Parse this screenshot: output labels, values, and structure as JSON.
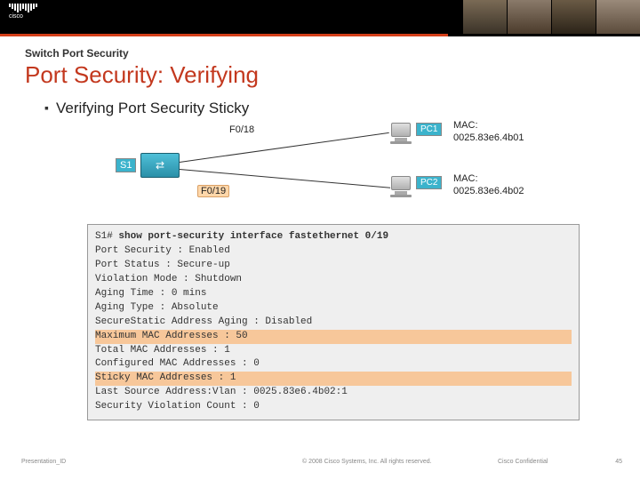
{
  "header": {
    "brand": "cisco"
  },
  "slide": {
    "overline": "Switch Port Security",
    "title": "Port Security: Verifying",
    "bullet": "Verifying Port Security Sticky"
  },
  "diagram": {
    "switch_label": "S1",
    "port_top": "F0/18",
    "port_bottom": "F0/19",
    "pc1_label": "PC1",
    "pc2_label": "PC2",
    "mac_label": "MAC:",
    "mac1": "0025.83e6.4b01",
    "mac2": "0025.83e6.4b02"
  },
  "terminal": {
    "prompt": "S1# ",
    "command": "show port-security interface fastethernet 0/19",
    "lines": [
      "Port Security : Enabled",
      "Port Status : Secure-up",
      "Violation Mode : Shutdown",
      "Aging Time : 0 mins",
      "Aging Type : Absolute",
      "SecureStatic Address Aging : Disabled",
      "Maximum MAC Addresses : 50",
      "Total MAC Addresses : 1",
      "Configured MAC Addresses : 0",
      "Sticky MAC Addresses : 1",
      "Last Source Address:Vlan : 0025.83e6.4b02:1",
      "Security Violation Count : 0"
    ],
    "highlight_indices": [
      6,
      9
    ]
  },
  "footer": {
    "id": "Presentation_ID",
    "copyright": "© 2008 Cisco Systems, Inc. All rights reserved.",
    "confidential": "Cisco Confidential",
    "page": "45"
  }
}
